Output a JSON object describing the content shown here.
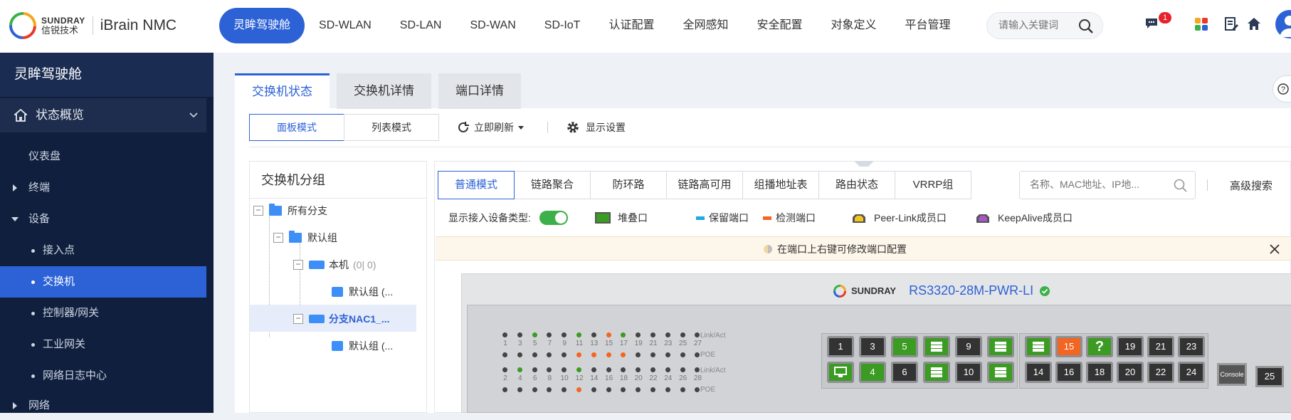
{
  "topbar": {
    "brand_top": "SUNDRAY",
    "brand_bottom": "信锐技术",
    "product": "iBrain NMC",
    "nav": [
      "灵眸驾驶舱",
      "SD-WLAN",
      "SD-LAN",
      "SD-WAN",
      "SD-IoT",
      "认证配置",
      "全网感知",
      "安全配置",
      "对象定义",
      "平台管理"
    ],
    "nav_active": 0,
    "search_placeholder": "请输入关键词",
    "notification_count": "1"
  },
  "sidebar": {
    "title": "灵眸驾驶舱",
    "items": [
      {
        "label": "状态概览",
        "type": "section"
      },
      {
        "label": "仪表盘",
        "type": "item"
      },
      {
        "label": "终端",
        "type": "group"
      },
      {
        "label": "设备",
        "type": "group-open"
      },
      {
        "label": "接入点",
        "type": "sub"
      },
      {
        "label": "交换机",
        "type": "sub-active"
      },
      {
        "label": "控制器/网关",
        "type": "sub"
      },
      {
        "label": "工业网关",
        "type": "sub"
      },
      {
        "label": "网络日志中心",
        "type": "sub"
      },
      {
        "label": "网络",
        "type": "group"
      }
    ]
  },
  "tabs": [
    "交换机状态",
    "交换机详情",
    "端口详情"
  ],
  "mode_buttons": [
    "面板模式",
    "列表模式"
  ],
  "toolbar": {
    "refresh": "立即刷新",
    "display_settings": "显示设置"
  },
  "tree": {
    "header": "交换机分组",
    "nodes": [
      {
        "label": "所有分支"
      },
      {
        "label": "默认组"
      },
      {
        "label": "本机",
        "extra": "(0| 0)"
      },
      {
        "label": "默认组 (..."
      },
      {
        "label": "分支NAC1_..."
      },
      {
        "label": "默认组 (..."
      }
    ]
  },
  "mode_tabs": [
    "普通模式",
    "链路聚合",
    "防环路",
    "链路高可用",
    "组播地址表",
    "路由状态",
    "VRRP组"
  ],
  "right_search_placeholder": "名称、MAC地址、IP地...",
  "advanced_search": "高级搜索",
  "legend": {
    "show_type": "显示接入设备类型:",
    "stack": "堆叠口",
    "reserved": "保留端口",
    "detect": "检测端口",
    "peerlink": "Peer-Link成员口",
    "keepalive": "KeepAlive成员口"
  },
  "notice": "在端口上右键可修改端口配置",
  "device": {
    "brand": "SUNDRAY",
    "model": "RS3320-28M-PWR-LI",
    "led_labels": {
      "link": "Link/Act",
      "poe": "POE"
    },
    "odd_ports": [
      "1",
      "3",
      "5",
      "7",
      "9",
      "11",
      "13",
      "15",
      "17",
      "19",
      "21",
      "23",
      "25",
      "27"
    ],
    "even_ports": [
      "2",
      "4",
      "6",
      "8",
      "10",
      "12",
      "14",
      "16",
      "18",
      "20",
      "22",
      "24",
      "26",
      "28"
    ],
    "odd_link_colors": [
      "#444",
      "#444",
      "#3c9b22",
      "#444",
      "#444",
      "#3c9b22",
      "#444",
      "#f26522",
      "#3c9b22",
      "#444",
      "#444",
      "#444",
      "#444",
      "#444"
    ],
    "odd_poe_colors": [
      "#444",
      "#444",
      "#444",
      "#444",
      "#444",
      "#f26522",
      "#f26522",
      "#f26522",
      "#f26522",
      "#444",
      "#444",
      "#444",
      "#444",
      "#444"
    ],
    "even_link_colors": [
      "#444",
      "#3c9b22",
      "#444",
      "#444",
      "#444",
      "#3c9b22",
      "#444",
      "#444",
      "#444",
      "#444",
      "#444",
      "#444",
      "#444",
      "#444"
    ],
    "even_poe_colors": [
      "#444",
      "#444",
      "#444",
      "#444",
      "#444",
      "#f26522",
      "#444",
      "#444",
      "#444",
      "#444",
      "#444",
      "#444",
      "#444",
      "#444"
    ],
    "top_ports_left": [
      "1",
      "3",
      "5",
      "",
      ""
    ],
    "top_ports_left_labels": [
      "1",
      "3",
      "5",
      "",
      "9",
      ""
    ],
    "top_ports_right_labels": [
      "",
      "15",
      "?",
      "19",
      "21",
      "23"
    ],
    "bottom_ports_left_labels": [
      "",
      "4",
      "6",
      "",
      "10",
      ""
    ],
    "bottom_ports_right_labels": [
      "14",
      "16",
      "18",
      "20",
      "22",
      "24"
    ],
    "console": "Console",
    "port_25": "25"
  }
}
